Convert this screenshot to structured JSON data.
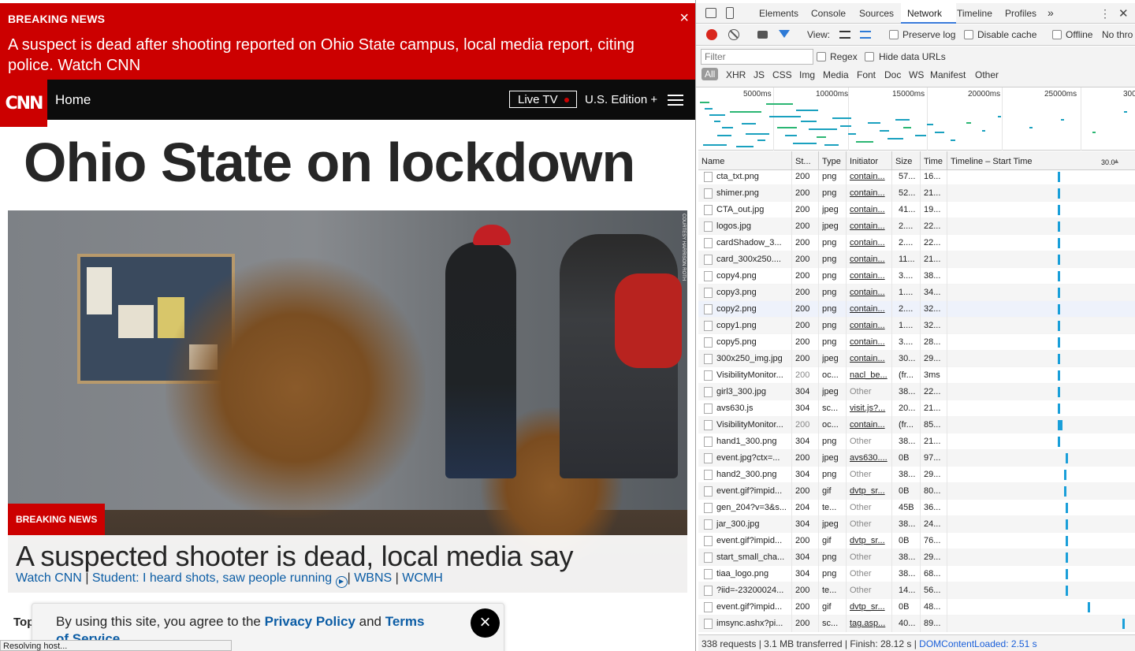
{
  "banner": {
    "label": "BREAKING NEWS",
    "text": "A suspect is dead after shooting reported on Ohio State campus, local media report, citing police. Watch CNN",
    "close": "×"
  },
  "nav": {
    "logo": "CNN",
    "home": "Home",
    "live_tv": "Live TV",
    "edition": "U.S. Edition +"
  },
  "headline": "Ohio State on lockdown",
  "hero": {
    "credit": "COURTESY HARRISON ROTH",
    "badge": "BREAKING NEWS",
    "title": "A suspected shooter is dead, local media say",
    "links": [
      "Watch CNN",
      "Student: I heard shots, saw people running",
      "WBNS",
      "WCMH"
    ],
    "separator": "|"
  },
  "top_label": "Top",
  "consent": {
    "prefix": "By using this site, you agree to the ",
    "privacy": "Privacy Policy",
    "and": " and ",
    "terms": "Terms of Service",
    "suffix": ".",
    "close": "×"
  },
  "browser_status": "Resolving host...",
  "devtools": {
    "tabs": [
      "Elements",
      "Console",
      "Sources",
      "Network",
      "Timeline",
      "Profiles"
    ],
    "active_tab": "Network",
    "more": "»",
    "menu": "⋮",
    "close": "✕",
    "toolbar": {
      "view": "View:",
      "preserve_log": "Preserve log",
      "disable_cache": "Disable cache",
      "offline": "Offline",
      "throttle": "No thro"
    },
    "filter_placeholder": "Filter",
    "regex": "Regex",
    "hide_data_urls": "Hide data URLs",
    "types": [
      "All",
      "XHR",
      "JS",
      "CSS",
      "Img",
      "Media",
      "Font",
      "Doc",
      "WS",
      "Manifest",
      "Other"
    ],
    "overview_ticks": [
      "5000ms",
      "10000ms",
      "15000ms",
      "20000ms",
      "25000ms",
      "300"
    ],
    "columns": [
      "Name",
      "St...",
      "Type",
      "Initiator",
      "Size",
      "Time",
      "Timeline – Start Time",
      "30.0"
    ],
    "rows": [
      {
        "name": "cta_txt.png",
        "status": "200",
        "type": "png",
        "initiator": "contain...",
        "size": "57...",
        "time": "16..."
      },
      {
        "name": "shimer.png",
        "status": "200",
        "type": "png",
        "initiator": "contain...",
        "size": "52...",
        "time": "21..."
      },
      {
        "name": "CTA_out.jpg",
        "status": "200",
        "type": "jpeg",
        "initiator": "contain...",
        "size": "41...",
        "time": "19..."
      },
      {
        "name": "logos.jpg",
        "status": "200",
        "type": "jpeg",
        "initiator": "contain...",
        "size": "2....",
        "time": "22..."
      },
      {
        "name": "cardShadow_3...",
        "status": "200",
        "type": "png",
        "initiator": "contain...",
        "size": "2....",
        "time": "22..."
      },
      {
        "name": "card_300x250....",
        "status": "200",
        "type": "png",
        "initiator": "contain...",
        "size": "11...",
        "time": "21..."
      },
      {
        "name": "copy4.png",
        "status": "200",
        "type": "png",
        "initiator": "contain...",
        "size": "3....",
        "time": "38..."
      },
      {
        "name": "copy3.png",
        "status": "200",
        "type": "png",
        "initiator": "contain...",
        "size": "1....",
        "time": "34..."
      },
      {
        "name": "copy2.png",
        "status": "200",
        "type": "png",
        "initiator": "contain...",
        "size": "2....",
        "time": "32..."
      },
      {
        "name": "copy1.png",
        "status": "200",
        "type": "png",
        "initiator": "contain...",
        "size": "1....",
        "time": "32..."
      },
      {
        "name": "copy5.png",
        "status": "200",
        "type": "png",
        "initiator": "contain...",
        "size": "3....",
        "time": "28..."
      },
      {
        "name": "300x250_img.jpg",
        "status": "200",
        "type": "jpeg",
        "initiator": "contain...",
        "size": "30...",
        "time": "29..."
      },
      {
        "name": "VisibilityMonitor...",
        "status": "200",
        "type": "oc...",
        "initiator": "nacl_be...",
        "size": "(fr...",
        "time": "3ms"
      },
      {
        "name": "girl3_300.jpg",
        "status": "304",
        "type": "jpeg",
        "initiator": "Other",
        "size": "38...",
        "time": "22..."
      },
      {
        "name": "avs630.js",
        "status": "304",
        "type": "sc...",
        "initiator": "visit.js?...",
        "size": "20...",
        "time": "21..."
      },
      {
        "name": "VisibilityMonitor...",
        "status": "200",
        "type": "oc...",
        "initiator": "contain...",
        "size": "(fr...",
        "time": "85..."
      },
      {
        "name": "hand1_300.png",
        "status": "304",
        "type": "png",
        "initiator": "Other",
        "size": "38...",
        "time": "21..."
      },
      {
        "name": "event.jpg?ctx=...",
        "status": "200",
        "type": "jpeg",
        "initiator": "avs630....",
        "size": "0B",
        "time": "97..."
      },
      {
        "name": "hand2_300.png",
        "status": "304",
        "type": "png",
        "initiator": "Other",
        "size": "38...",
        "time": "29..."
      },
      {
        "name": "event.gif?impid...",
        "status": "200",
        "type": "gif",
        "initiator": "dvtp_sr...",
        "size": "0B",
        "time": "80..."
      },
      {
        "name": "gen_204?v=3&s...",
        "status": "204",
        "type": "te...",
        "initiator": "Other",
        "size": "45B",
        "time": "36..."
      },
      {
        "name": "jar_300.jpg",
        "status": "304",
        "type": "jpeg",
        "initiator": "Other",
        "size": "38...",
        "time": "24..."
      },
      {
        "name": "event.gif?impid...",
        "status": "200",
        "type": "gif",
        "initiator": "dvtp_sr...",
        "size": "0B",
        "time": "76..."
      },
      {
        "name": "start_small_cha...",
        "status": "304",
        "type": "png",
        "initiator": "Other",
        "size": "38...",
        "time": "29..."
      },
      {
        "name": "tiaa_logo.png",
        "status": "304",
        "type": "png",
        "initiator": "Other",
        "size": "38...",
        "time": "68..."
      },
      {
        "name": "?iid=-23200024...",
        "status": "200",
        "type": "te...",
        "initiator": "Other",
        "size": "14...",
        "time": "56..."
      },
      {
        "name": "event.gif?impid...",
        "status": "200",
        "type": "gif",
        "initiator": "dvtp_sr...",
        "size": "0B",
        "time": "48..."
      },
      {
        "name": "imsync.ashx?pi...",
        "status": "200",
        "type": "sc...",
        "initiator": "tag.asp...",
        "size": "40...",
        "time": "89..."
      }
    ],
    "status_bar": "338 requests | 3.1 MB transferred | Finish: 28.12 s | ",
    "dom_loaded": "DOMContentLoaded: 2.51 s"
  }
}
